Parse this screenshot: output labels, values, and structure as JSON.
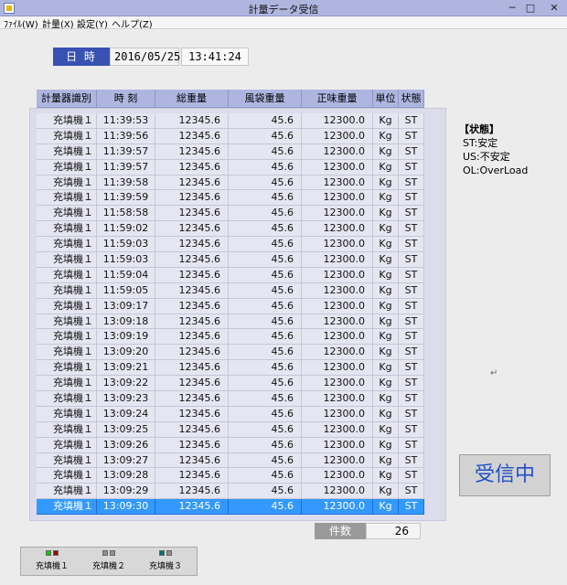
{
  "window": {
    "title": "計量データ受信",
    "min_glyph": "─",
    "max_glyph": "□",
    "close_glyph": "✕"
  },
  "menu": [
    {
      "label": "ﾌｧｲﾙ(W)"
    },
    {
      "label": "計量(X)"
    },
    {
      "label": "設定(Y)"
    },
    {
      "label": "ヘルプ(Z)"
    }
  ],
  "datetime": {
    "label": "日 時",
    "date": "2016/05/25",
    "time": "13:41:24"
  },
  "table": {
    "headers": [
      "計量器識別",
      "時 刻",
      "総重量",
      "風袋重量",
      "正味重量",
      "単位",
      "状態"
    ],
    "rows": [
      [
        "充填機１",
        "11:39:53",
        "12345.6",
        "45.6",
        "12300.0",
        "Kg",
        "ST"
      ],
      [
        "充填機１",
        "11:39:56",
        "12345.6",
        "45.6",
        "12300.0",
        "Kg",
        "ST"
      ],
      [
        "充填機１",
        "11:39:57",
        "12345.6",
        "45.6",
        "12300.0",
        "Kg",
        "ST"
      ],
      [
        "充填機１",
        "11:39:57",
        "12345.6",
        "45.6",
        "12300.0",
        "Kg",
        "ST"
      ],
      [
        "充填機１",
        "11:39:58",
        "12345.6",
        "45.6",
        "12300.0",
        "Kg",
        "ST"
      ],
      [
        "充填機１",
        "11:39:59",
        "12345.6",
        "45.6",
        "12300.0",
        "Kg",
        "ST"
      ],
      [
        "充填機１",
        "11:58:58",
        "12345.6",
        "45.6",
        "12300.0",
        "Kg",
        "ST"
      ],
      [
        "充填機１",
        "11:59:02",
        "12345.6",
        "45.6",
        "12300.0",
        "Kg",
        "ST"
      ],
      [
        "充填機１",
        "11:59:03",
        "12345.6",
        "45.6",
        "12300.0",
        "Kg",
        "ST"
      ],
      [
        "充填機１",
        "11:59:03",
        "12345.6",
        "45.6",
        "12300.0",
        "Kg",
        "ST"
      ],
      [
        "充填機１",
        "11:59:04",
        "12345.6",
        "45.6",
        "12300.0",
        "Kg",
        "ST"
      ],
      [
        "充填機１",
        "11:59:05",
        "12345.6",
        "45.6",
        "12300.0",
        "Kg",
        "ST"
      ],
      [
        "充填機１",
        "13:09:17",
        "12345.6",
        "45.6",
        "12300.0",
        "Kg",
        "ST"
      ],
      [
        "充填機１",
        "13:09:18",
        "12345.6",
        "45.6",
        "12300.0",
        "Kg",
        "ST"
      ],
      [
        "充填機１",
        "13:09:19",
        "12345.6",
        "45.6",
        "12300.0",
        "Kg",
        "ST"
      ],
      [
        "充填機１",
        "13:09:20",
        "12345.6",
        "45.6",
        "12300.0",
        "Kg",
        "ST"
      ],
      [
        "充填機１",
        "13:09:21",
        "12345.6",
        "45.6",
        "12300.0",
        "Kg",
        "ST"
      ],
      [
        "充填機１",
        "13:09:22",
        "12345.6",
        "45.6",
        "12300.0",
        "Kg",
        "ST"
      ],
      [
        "充填機１",
        "13:09:23",
        "12345.6",
        "45.6",
        "12300.0",
        "Kg",
        "ST"
      ],
      [
        "充填機１",
        "13:09:24",
        "12345.6",
        "45.6",
        "12300.0",
        "Kg",
        "ST"
      ],
      [
        "充填機１",
        "13:09:25",
        "12345.6",
        "45.6",
        "12300.0",
        "Kg",
        "ST"
      ],
      [
        "充填機１",
        "13:09:26",
        "12345.6",
        "45.6",
        "12300.0",
        "Kg",
        "ST"
      ],
      [
        "充填機１",
        "13:09:27",
        "12345.6",
        "45.6",
        "12300.0",
        "Kg",
        "ST"
      ],
      [
        "充填機１",
        "13:09:28",
        "12345.6",
        "45.6",
        "12300.0",
        "Kg",
        "ST"
      ],
      [
        "充填機１",
        "13:09:29",
        "12345.6",
        "45.6",
        "12300.0",
        "Kg",
        "ST"
      ],
      [
        "充填機１",
        "13:09:30",
        "12345.6",
        "45.6",
        "12300.0",
        "Kg",
        "ST"
      ]
    ],
    "selected_row": 25
  },
  "status_legend": {
    "title": "【状態】",
    "items": [
      "ST:安定",
      "US:不安定",
      "OL:OverLoad"
    ]
  },
  "cursor_mark": "↵",
  "receive_button": "受信中",
  "count": {
    "label": "件数",
    "value": "26"
  },
  "devices": [
    {
      "label": "充填機１",
      "lamp_colors": [
        "#00d000",
        "#a00000"
      ]
    },
    {
      "label": "充填機２",
      "lamp_colors": [
        "#909090",
        "#909090"
      ]
    },
    {
      "label": "充填機３",
      "lamp_colors": [
        "#007070",
        "#909090"
      ]
    }
  ],
  "colors": {
    "accent": "#3852b3",
    "header_bg": "#aeb6e0",
    "selected_row": "#3399ff",
    "receive_text": "#2250c8"
  }
}
